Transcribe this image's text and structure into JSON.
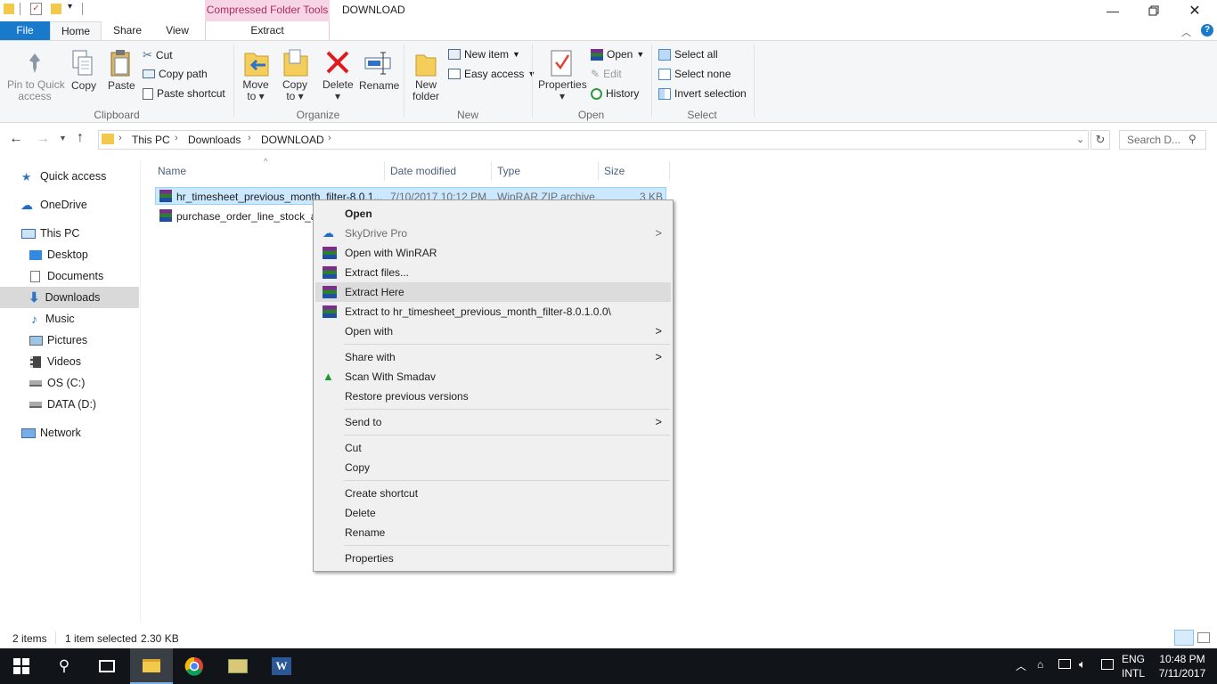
{
  "window": {
    "title": "DOWNLOAD",
    "context_tab": "Compressed Folder Tools",
    "context_tab_sub": "Extract"
  },
  "tabs": {
    "file": "File",
    "home": "Home",
    "share": "Share",
    "view": "View",
    "extract": "Extract"
  },
  "ribbon": {
    "clipboard": {
      "pin": "Pin to Quick access",
      "pin_l1": "Pin to Quick",
      "pin_l2": "access",
      "copy": "Copy",
      "paste": "Paste",
      "cut": "Cut",
      "copy_path": "Copy path",
      "paste_shortcut": "Paste shortcut",
      "group": "Clipboard"
    },
    "organize": {
      "move_l1": "Move",
      "move_l2": "to",
      "copy_l1": "Copy",
      "copy_l2": "to",
      "delete": "Delete",
      "rename": "Rename",
      "group": "Organize"
    },
    "new": {
      "new_l1": "New",
      "new_l2": "folder",
      "new_item": "New item",
      "easy_access": "Easy access",
      "group": "New"
    },
    "open": {
      "properties": "Properties",
      "open": "Open",
      "edit": "Edit",
      "history": "History",
      "group": "Open"
    },
    "select": {
      "select_all": "Select all",
      "select_none": "Select none",
      "invert": "Invert selection",
      "group": "Select"
    }
  },
  "address": {
    "crumbs": [
      "This PC",
      "Downloads",
      "DOWNLOAD"
    ],
    "search_placeholder": "Search D..."
  },
  "nav": {
    "quick_access": "Quick access",
    "onedrive": "OneDrive",
    "this_pc": "This PC",
    "desktop": "Desktop",
    "documents": "Documents",
    "downloads": "Downloads",
    "music": "Music",
    "pictures": "Pictures",
    "videos": "Videos",
    "os_c": "OS (C:)",
    "data_d": "DATA (D:)",
    "network": "Network"
  },
  "columns": {
    "name": "Name",
    "date": "Date modified",
    "type": "Type",
    "size": "Size"
  },
  "files": [
    {
      "name": "hr_timesheet_previous_month_filter-8.0.1...",
      "date": "7/10/2017 10:12 PM",
      "type": "WinRAR ZIP archive",
      "size": "3 KB"
    },
    {
      "name": "purchase_order_line_stock_av",
      "date": "",
      "type": "",
      "size": ""
    }
  ],
  "context_menu": {
    "open": "Open",
    "skydrive": "SkyDrive Pro",
    "open_winrar": "Open with WinRAR",
    "extract_files": "Extract files...",
    "extract_here": "Extract Here",
    "extract_to": "Extract to hr_timesheet_previous_month_filter-8.0.1.0.0\\",
    "open_with": "Open with",
    "share_with": "Share with",
    "scan_smadav": "Scan With Smadav",
    "restore": "Restore previous versions",
    "send_to": "Send to",
    "cut": "Cut",
    "copy": "Copy",
    "create_shortcut": "Create shortcut",
    "delete": "Delete",
    "rename": "Rename",
    "properties": "Properties"
  },
  "status": {
    "items": "2 items",
    "selected": "1 item selected",
    "size": "2.30 KB"
  },
  "taskbar": {
    "lang1": "ENG",
    "lang2": "INTL",
    "time": "10:48 PM",
    "date": "7/11/2017"
  },
  "colors": {
    "accent": "#1979ca",
    "selection": "#cce8ff",
    "context_tab": "#f6d6e6",
    "taskbar": "#111418"
  }
}
